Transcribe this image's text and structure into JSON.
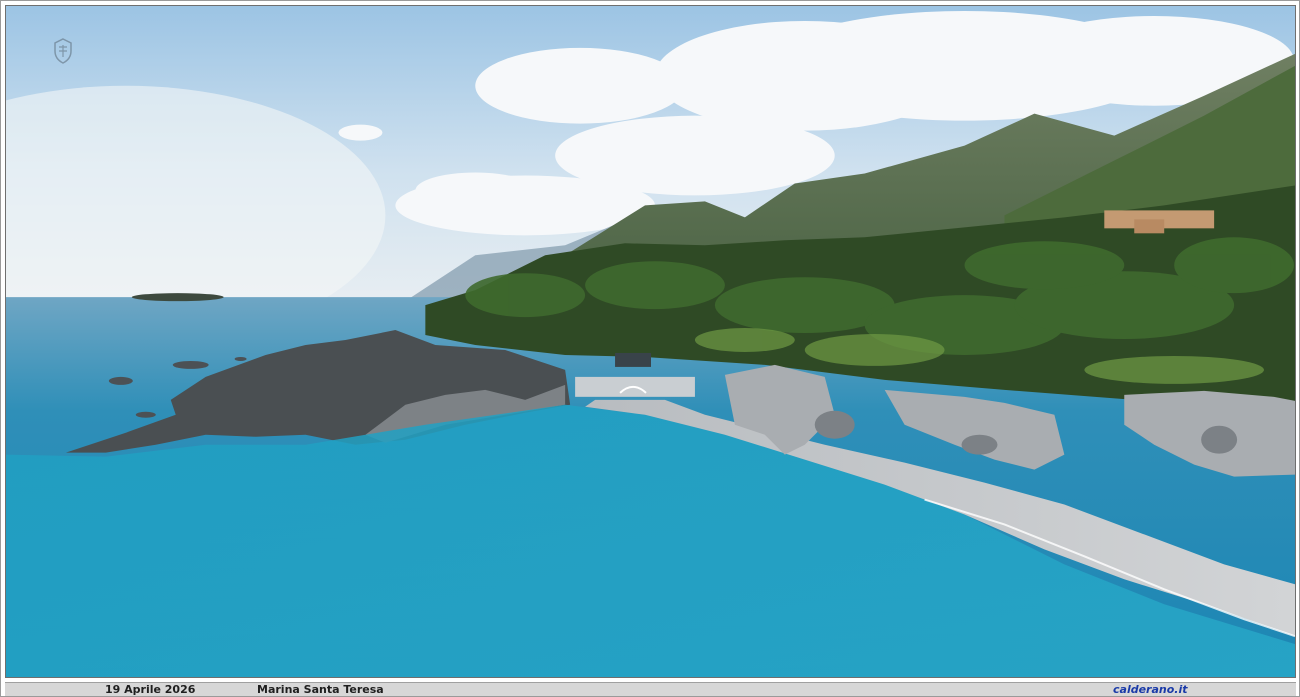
{
  "caption": {
    "date": "19 Aprile 2026",
    "place": "Marina Santa Teresa",
    "site": "calderano.it"
  },
  "photo": {
    "subject": "aerial-coastal-view",
    "icons": [
      "logo-crest-icon"
    ]
  },
  "colors": {
    "caption_bar": "#d7d7d7",
    "site_link": "#1a3aa8",
    "sea": "#1f8fb8"
  }
}
